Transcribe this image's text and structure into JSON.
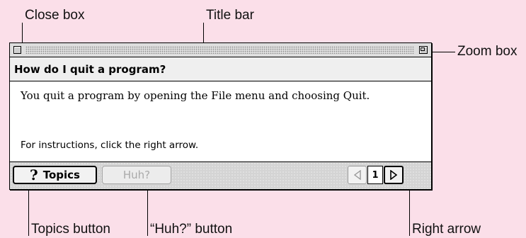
{
  "callouts": {
    "close_box": "Close box",
    "title_bar": "Title bar",
    "zoom_box": "Zoom box",
    "topics_button": "Topics button",
    "huh_button": "“Huh?” button",
    "right_arrow": "Right arrow"
  },
  "help_window": {
    "question": "How do I quit a program?",
    "answer": "You quit a program by opening the File menu and choosing Quit.",
    "instructions": "For instructions, click the right arrow.",
    "topics_label": "Topics",
    "topics_icon": "question-mark-icon",
    "huh_label": "Huh?",
    "huh_enabled": false,
    "page_number": "1",
    "left_arrow_enabled": false,
    "right_arrow_enabled": true
  },
  "colors": {
    "background": "#fbdfe9",
    "window": "#ffffff",
    "question_band": "#efefef",
    "bottom_bar": "#d4d4d4",
    "disabled_text": "#a9a9a9"
  }
}
